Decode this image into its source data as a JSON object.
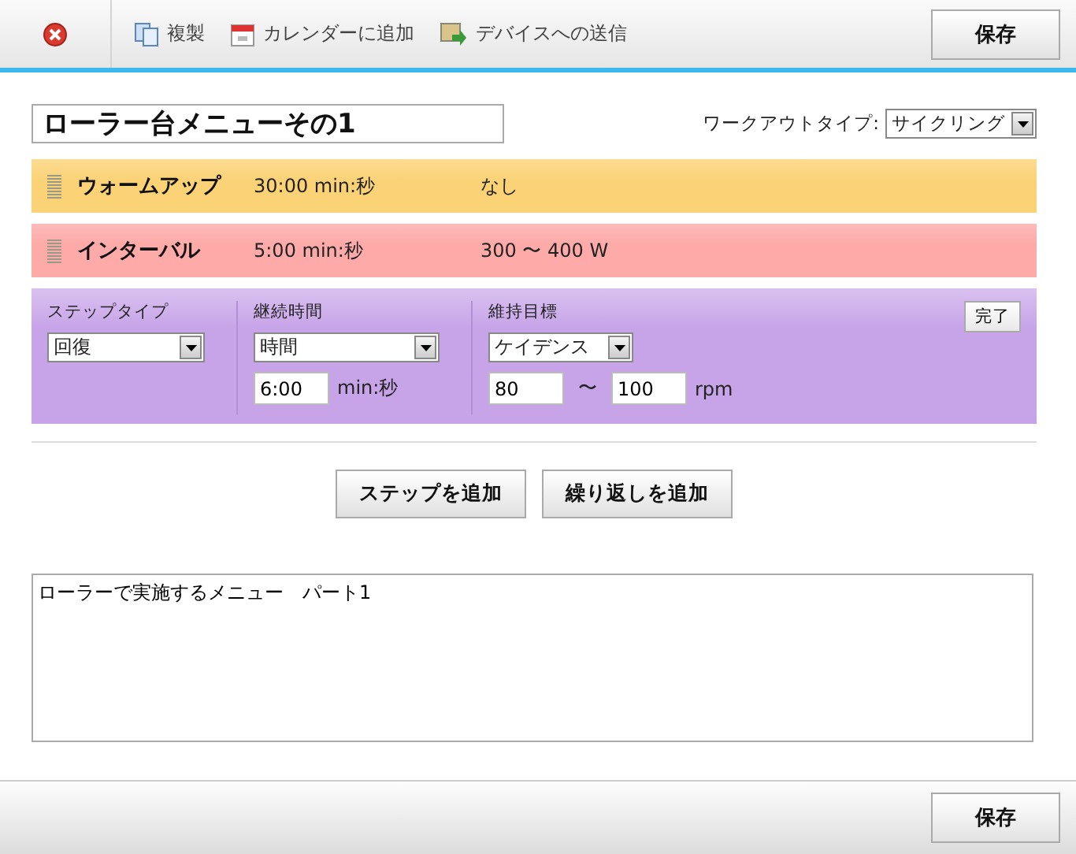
{
  "toolbar": {
    "items": [
      {
        "kind": "copy",
        "label": "複製"
      },
      {
        "kind": "calendar",
        "label": "カレンダーに追加"
      },
      {
        "kind": "device",
        "label": "デバイスへの送信"
      }
    ],
    "save": "保存"
  },
  "title": {
    "value": "ローラー台メニューその1"
  },
  "workout_type": {
    "label": "ワークアウトタイプ:",
    "value": "サイクリング"
  },
  "steps": [
    {
      "kind": "summary",
      "color": "#fbd276",
      "name": "ウォームアップ",
      "duration": "30:00 min:秒",
      "target": "なし"
    },
    {
      "kind": "summary",
      "color": "#fdaaa8",
      "name": "インターバル",
      "duration": "5:00 min:秒",
      "target": "300 〜 400 W"
    },
    {
      "kind": "editor",
      "color": "#c7a3e8",
      "step_type_label": "ステップタイプ",
      "step_type": "回復",
      "duration_label": "継続時間",
      "duration_type": "時間",
      "duration": "6:00",
      "duration_unit": "min:秒",
      "target_label": "維持目標",
      "target_type": "ケイデンス",
      "target_low": "80",
      "target_sep": "〜",
      "target_high": "100",
      "target_unit": "rpm",
      "done": "完了"
    }
  ],
  "actions": [
    "ステップを追加",
    "繰り返しを追加"
  ],
  "notes": {
    "value": "ローラーで実施するメニュー　パート1"
  },
  "footer": {
    "save": "保存"
  }
}
